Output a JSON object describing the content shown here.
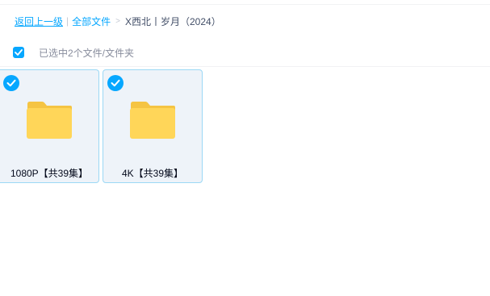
{
  "breadcrumb": {
    "back_label": "返回上一级",
    "separator": "|",
    "root_label": "全部文件",
    "arrow": ">",
    "current_label": "X西北丨岁月（2024）"
  },
  "selection": {
    "checked": true,
    "text": "已选中2个文件/文件夹"
  },
  "files": [
    {
      "name": "1080P【共39集】",
      "type": "folder",
      "selected": true,
      "icon": "folder-icon"
    },
    {
      "name": "4K【共39集】",
      "type": "folder",
      "selected": true,
      "icon": "folder-icon"
    }
  ],
  "colors": {
    "accent": "#06a7ff",
    "folder_body": "#ffd659",
    "folder_tab": "#f5c443",
    "card_bg": "#eef3f9",
    "card_border": "#9bd8f5"
  }
}
